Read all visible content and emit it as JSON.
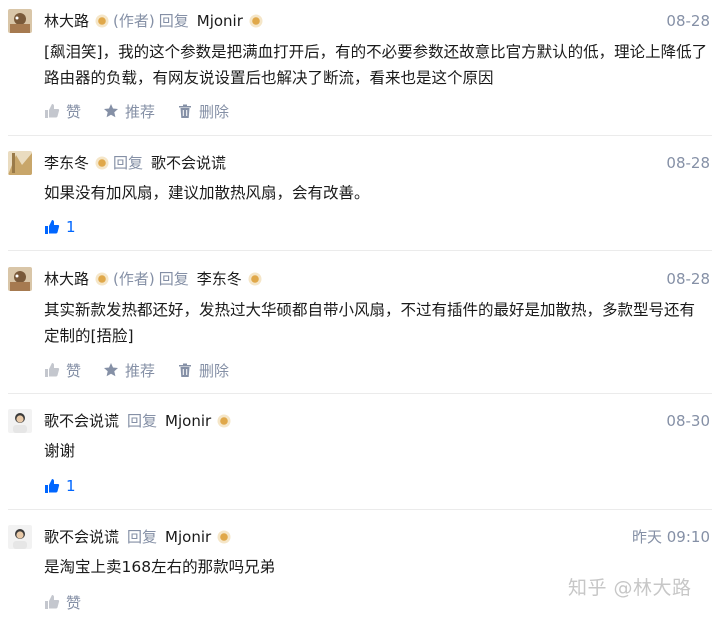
{
  "comments": [
    {
      "author": "林大路",
      "role": "(作者)",
      "reply_word": "回复",
      "target": "Mjonir",
      "date": "08-28",
      "text": "[飙泪笑]，我的这个参数是把满血打开后，有的不必要参数还故意比官方默认的低，理论上降低了路由器的负载，有网友说设置后也解决了断流，看来也是这个原因",
      "actions": {
        "like": "赞",
        "recommend": "推荐",
        "delete": "删除"
      }
    },
    {
      "author": "李东冬",
      "reply_word": "回复",
      "target": "歌不会说谎",
      "date": "08-28",
      "text": "如果没有加风扇，建议加散热风扇，会有改善。",
      "actions": {
        "like_count": "1"
      }
    },
    {
      "author": "林大路",
      "role": "(作者)",
      "reply_word": "回复",
      "target": "李东冬",
      "date": "08-28",
      "text": "其实新款发热都还好，发热过大华硕都自带小风扇，不过有插件的最好是加散热，多款型号还有定制的[捂脸]",
      "actions": {
        "like": "赞",
        "recommend": "推荐",
        "delete": "删除"
      }
    },
    {
      "author": "歌不会说谎",
      "reply_word": "回复",
      "target": "Mjonir",
      "date": "08-30",
      "text": "谢谢",
      "actions": {
        "like_count": "1"
      }
    },
    {
      "author": "歌不会说谎",
      "reply_word": "回复",
      "target": "Mjonir",
      "date": "昨天 09:10",
      "text": "是淘宝上卖168左右的那款吗兄弟",
      "actions": {
        "like": "赞"
      }
    }
  ],
  "watermark": "知乎 @林大路",
  "colors": {
    "meta_gray": "#8590a6",
    "link_blue": "#0066ff",
    "divider": "#ebebeb"
  }
}
